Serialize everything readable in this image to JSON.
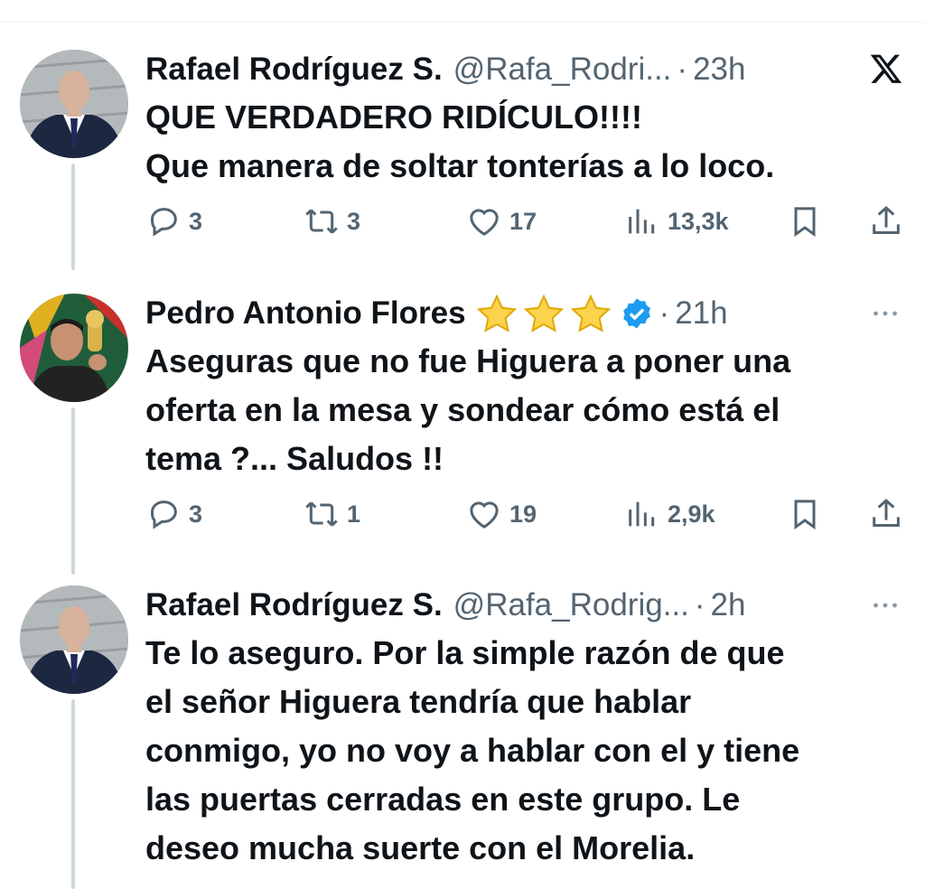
{
  "tweets": [
    {
      "name": "Rafael Rodríguez S.",
      "handle": "@Rafa_Rodri...",
      "time": "23h",
      "body": [
        "QUE VERDADERO RIDÍCULO!!!!",
        "Que manera de soltar tonterías a lo loco."
      ],
      "replies": "3",
      "retweets": "3",
      "likes": "17",
      "views": "13,3k",
      "corner_icon": "x-logo-icon"
    },
    {
      "name": "Pedro Antonio Flores",
      "handle": "",
      "time": "21h",
      "stars": [
        "star-emoji",
        "star-emoji",
        "star-emoji"
      ],
      "verified": true,
      "body": [
        "Aseguras que no fue Higuera a poner una",
        "oferta en la mesa y sondear cómo está el",
        "tema ?... Saludos !!"
      ],
      "replies": "3",
      "retweets": "1",
      "likes": "19",
      "views": "2,9k",
      "corner_icon": "more-icon"
    },
    {
      "name": "Rafael Rodríguez S.",
      "handle": "@Rafa_Rodrig...",
      "time": "2h",
      "body": [
        "Te lo aseguro. Por la simple razón de que",
        "el señor Higuera tendría que hablar",
        "conmigo, yo no voy a hablar con el y tiene",
        "las puertas cerradas en este grupo. Le",
        "deseo mucha suerte con el Morelia."
      ],
      "corner_icon": "more-icon"
    }
  ],
  "colors": {
    "text": "#0f1419",
    "secondary": "#536471",
    "verified": "#1d9bf0",
    "thread": "#cfd9de"
  }
}
